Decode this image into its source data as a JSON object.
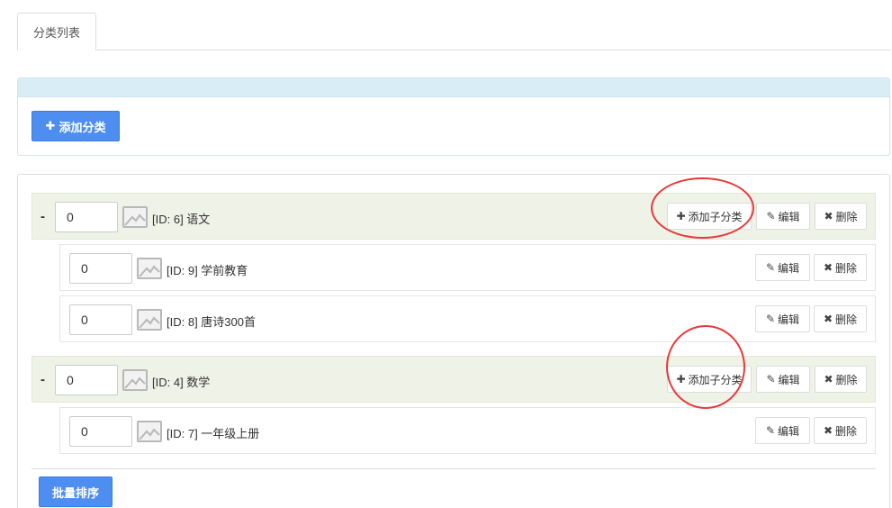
{
  "tabs": [
    {
      "label": "分类列表"
    }
  ],
  "toolbar": {
    "add_category_label": "添加分类",
    "add_category_icon": "plus-icon"
  },
  "actions": {
    "add_child_label": "添加子分类",
    "edit_label": "编辑",
    "delete_label": "删除",
    "batch_sort_label": "批量排序"
  },
  "categories": [
    {
      "sort": "0",
      "label": "[ID: 6] 语文",
      "collapse": "-"
    },
    {
      "sort": "0",
      "label": "[ID: 9] 学前教育"
    },
    {
      "sort": "0",
      "label": "[ID: 8] 唐诗300首"
    },
    {
      "sort": "0",
      "label": "[ID: 4] 数学",
      "collapse": "-"
    },
    {
      "sort": "0",
      "label": "[ID: 7] 一年级上册"
    }
  ],
  "colors": {
    "primary": "#4d8ef0",
    "panel_header": "#d9edf7",
    "parent_row": "#eff2e6",
    "annotation": "#e8393a"
  }
}
